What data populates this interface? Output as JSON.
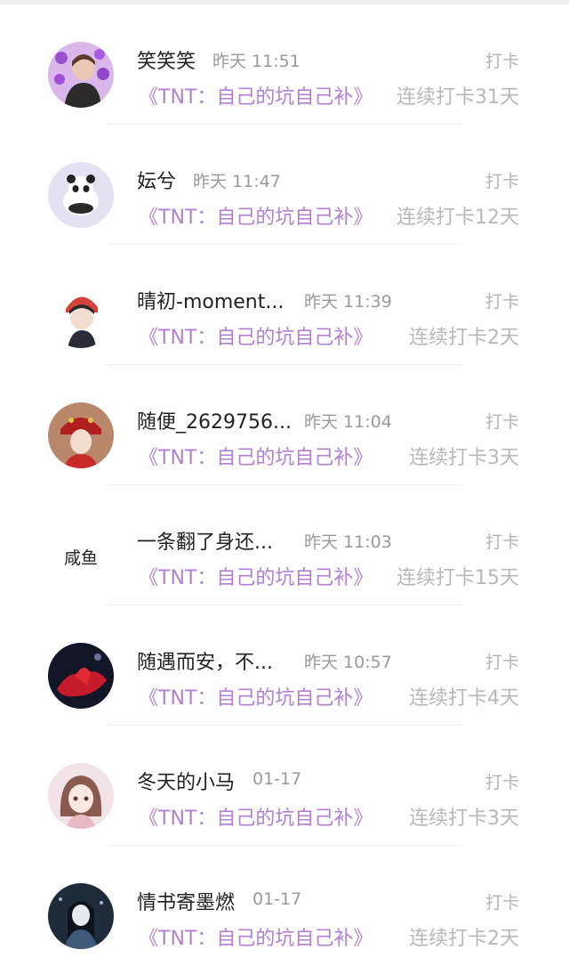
{
  "feed": [
    {
      "name": "笑笑笑",
      "time": "昨天 11:51",
      "action": "打卡",
      "topic": "《TNT：自己的坑自己补》",
      "streak": "连续打卡31天"
    },
    {
      "name": "妘兮",
      "time": "昨天 11:47",
      "action": "打卡",
      "topic": "《TNT：自己的坑自己补》",
      "streak": "连续打卡12天"
    },
    {
      "name": "晴初-moment...",
      "time": "昨天 11:39",
      "action": "打卡",
      "topic": "《TNT：自己的坑自己补》",
      "streak": "连续打卡2天"
    },
    {
      "name": "随便_2629756...",
      "time": "昨天 11:04",
      "action": "打卡",
      "topic": "《TNT：自己的坑自己补》",
      "streak": "连续打卡3天"
    },
    {
      "name": "一条翻了身还...",
      "time": "昨天 11:03",
      "action": "打卡",
      "topic": "《TNT：自己的坑自己补》",
      "streak": "连续打卡15天",
      "avatar_text": "咸鱼"
    },
    {
      "name": "随遇而安，不...",
      "time": "昨天 10:57",
      "action": "打卡",
      "topic": "《TNT：自己的坑自己补》",
      "streak": "连续打卡4天"
    },
    {
      "name": "冬天的小马",
      "time": "01-17",
      "action": "打卡",
      "topic": "《TNT：自己的坑自己补》",
      "streak": "连续打卡3天"
    },
    {
      "name": "情书寄墨燃",
      "time": "01-17",
      "action": "打卡",
      "topic": "《TNT：自己的坑自己补》",
      "streak": "连续打卡2天"
    }
  ],
  "colors": {
    "topic": "#b37fd3",
    "muted": "#9a9a9a",
    "name": "#222222"
  }
}
